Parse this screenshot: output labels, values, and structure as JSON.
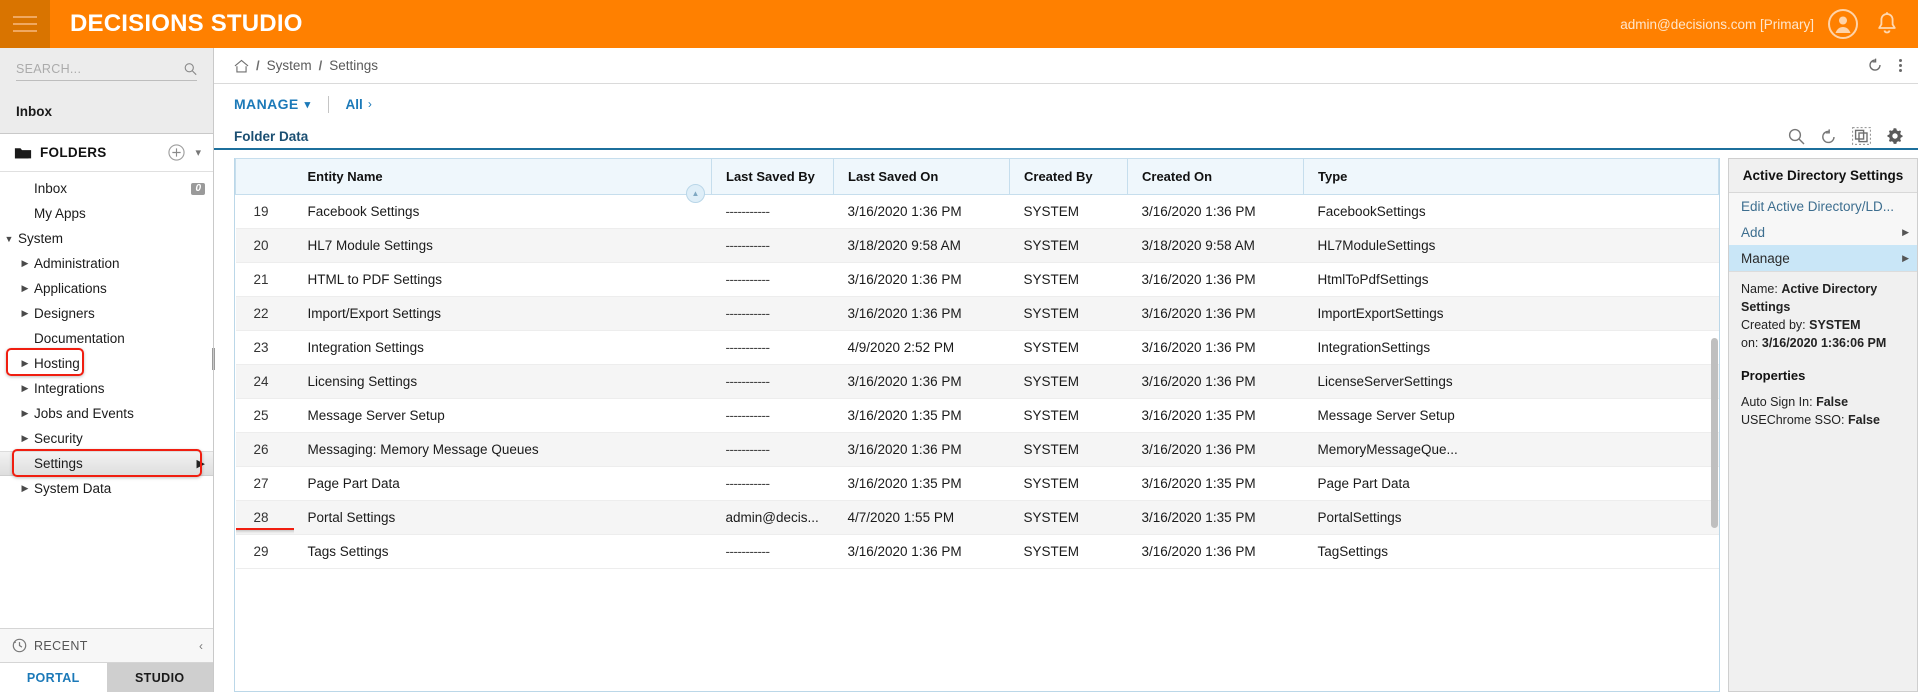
{
  "topbar": {
    "brand": "DECISIONS STUDIO",
    "user_email": "admin@decisions.com [Primary]",
    "hamburger_icon": "hamburger-menu-icon",
    "avatar_icon": "user-avatar-icon",
    "bell_icon": "notification-bell-icon",
    "accent_color": "#FF8000"
  },
  "sidebar": {
    "search": {
      "placeholder": "SEARCH...",
      "value": "",
      "icon": "search-icon"
    },
    "inbox_top": "Inbox",
    "folders_header": {
      "label": "FOLDERS",
      "folder_icon": "folder-icon",
      "add_icon": "plus-circle-icon",
      "chevron_icon": "chevron-down-icon"
    },
    "tree": [
      {
        "label": "Inbox",
        "arrow": "",
        "indent": 1,
        "badge": "0"
      },
      {
        "label": "My Apps",
        "arrow": "",
        "indent": 1,
        "badge": ""
      },
      {
        "label": "System",
        "arrow": "▼",
        "indent": 0,
        "badge": "",
        "highlighted": true
      },
      {
        "label": "Administration",
        "arrow": "▶",
        "indent": 1,
        "badge": ""
      },
      {
        "label": "Applications",
        "arrow": "▶",
        "indent": 1,
        "badge": ""
      },
      {
        "label": "Designers",
        "arrow": "▶",
        "indent": 1,
        "badge": ""
      },
      {
        "label": "Documentation",
        "arrow": "",
        "indent": 1,
        "badge": ""
      },
      {
        "label": "Hosting",
        "arrow": "▶",
        "indent": 1,
        "badge": ""
      },
      {
        "label": "Integrations",
        "arrow": "▶",
        "indent": 1,
        "badge": ""
      },
      {
        "label": "Jobs and Events",
        "arrow": "▶",
        "indent": 1,
        "badge": ""
      },
      {
        "label": "Security",
        "arrow": "▶",
        "indent": 1,
        "badge": ""
      },
      {
        "label": "Settings",
        "arrow": "",
        "indent": 1,
        "badge": "",
        "selected": true,
        "highlighted": true,
        "chevron_right": "▶"
      },
      {
        "label": "System Data",
        "arrow": "▶",
        "indent": 1,
        "badge": ""
      }
    ],
    "recent": {
      "label": "RECENT",
      "clock_icon": "clock-icon",
      "collapse_icon": "chevron-left-icon"
    },
    "bottom_tabs": [
      {
        "label": "PORTAL",
        "active": true
      },
      {
        "label": "STUDIO",
        "active": false
      }
    ]
  },
  "breadcrumb": {
    "home_icon": "home-icon",
    "items": [
      "System",
      "Settings"
    ],
    "separator": "/",
    "refresh_icon": "refresh-icon",
    "kebab_icon": "more-vertical-icon"
  },
  "toolbar": {
    "manage_label": "MANAGE",
    "manage_chevron": "⌄",
    "all_label": "All",
    "all_chevron": "›"
  },
  "grid": {
    "title": "Folder Data",
    "tools": [
      "search-icon",
      "undo-icon",
      "duplicate-icon",
      "gear-icon"
    ],
    "columns": [
      "",
      "Entity Name",
      "Last Saved By",
      "Last Saved On",
      "Created By",
      "Created On",
      "Type"
    ],
    "rows": [
      {
        "idx": "19",
        "name": "Facebook Settings",
        "last_saved_by": "-----------",
        "last_saved_on": "3/16/2020 1:36 PM",
        "created_by": "SYSTEM",
        "created_on": "3/16/2020 1:36 PM",
        "type": "FacebookSettings"
      },
      {
        "idx": "20",
        "name": "HL7 Module Settings",
        "last_saved_by": "-----------",
        "last_saved_on": "3/18/2020 9:58 AM",
        "created_by": "SYSTEM",
        "created_on": "3/18/2020 9:58 AM",
        "type": "HL7ModuleSettings"
      },
      {
        "idx": "21",
        "name": "HTML to PDF Settings",
        "last_saved_by": "-----------",
        "last_saved_on": "3/16/2020 1:36 PM",
        "created_by": "SYSTEM",
        "created_on": "3/16/2020 1:36 PM",
        "type": "HtmlToPdfSettings"
      },
      {
        "idx": "22",
        "name": "Import/Export Settings",
        "last_saved_by": "-----------",
        "last_saved_on": "3/16/2020 1:36 PM",
        "created_by": "SYSTEM",
        "created_on": "3/16/2020 1:36 PM",
        "type": "ImportExportSettings"
      },
      {
        "idx": "23",
        "name": "Integration Settings",
        "last_saved_by": "-----------",
        "last_saved_on": "4/9/2020 2:52 PM",
        "created_by": "SYSTEM",
        "created_on": "3/16/2020 1:36 PM",
        "type": "IntegrationSettings"
      },
      {
        "idx": "24",
        "name": "Licensing Settings",
        "last_saved_by": "-----------",
        "last_saved_on": "3/16/2020 1:36 PM",
        "created_by": "SYSTEM",
        "created_on": "3/16/2020 1:36 PM",
        "type": "LicenseServerSettings"
      },
      {
        "idx": "25",
        "name": "Message Server Setup",
        "last_saved_by": "-----------",
        "last_saved_on": "3/16/2020 1:35 PM",
        "created_by": "SYSTEM",
        "created_on": "3/16/2020 1:35 PM",
        "type": "Message Server Setup"
      },
      {
        "idx": "26",
        "name": "Messaging: Memory Message Queues",
        "last_saved_by": "-----------",
        "last_saved_on": "3/16/2020 1:36 PM",
        "created_by": "SYSTEM",
        "created_on": "3/16/2020 1:36 PM",
        "type": "MemoryMessageQue..."
      },
      {
        "idx": "27",
        "name": "Page Part Data",
        "last_saved_by": "-----------",
        "last_saved_on": "3/16/2020 1:35 PM",
        "created_by": "SYSTEM",
        "created_on": "3/16/2020 1:35 PM",
        "type": "Page Part Data"
      },
      {
        "idx": "28",
        "name": "Portal Settings",
        "last_saved_by": "admin@decis...",
        "last_saved_on": "4/7/2020 1:55 PM",
        "created_by": "SYSTEM",
        "created_on": "3/16/2020 1:35 PM",
        "type": "PortalSettings",
        "highlighted": true
      },
      {
        "idx": "29",
        "name": "Tags Settings",
        "last_saved_by": "-----------",
        "last_saved_on": "3/16/2020 1:36 PM",
        "created_by": "SYSTEM",
        "created_on": "3/16/2020 1:36 PM",
        "type": "TagSettings"
      }
    ]
  },
  "right_panel": {
    "title": "Active Directory Settings",
    "menu": [
      {
        "label": "Edit Active Directory/LD...",
        "arrow": ""
      },
      {
        "label": "Add",
        "arrow": "▶"
      },
      {
        "label": "Manage",
        "arrow": "▶",
        "highlighted": true
      }
    ],
    "meta": {
      "name_label": "Name:",
      "name_value": "Active Directory Settings",
      "created_by_label": "Created by:",
      "created_by_value": "SYSTEM",
      "on_label": "on:",
      "on_value": "3/16/2020 1:36:06 PM"
    },
    "properties_title": "Properties",
    "properties": [
      {
        "label": "Auto Sign In:",
        "value": "False"
      },
      {
        "label": "USEChrome SSO:",
        "value": "False"
      }
    ]
  },
  "highlight_color": "#F01E10"
}
